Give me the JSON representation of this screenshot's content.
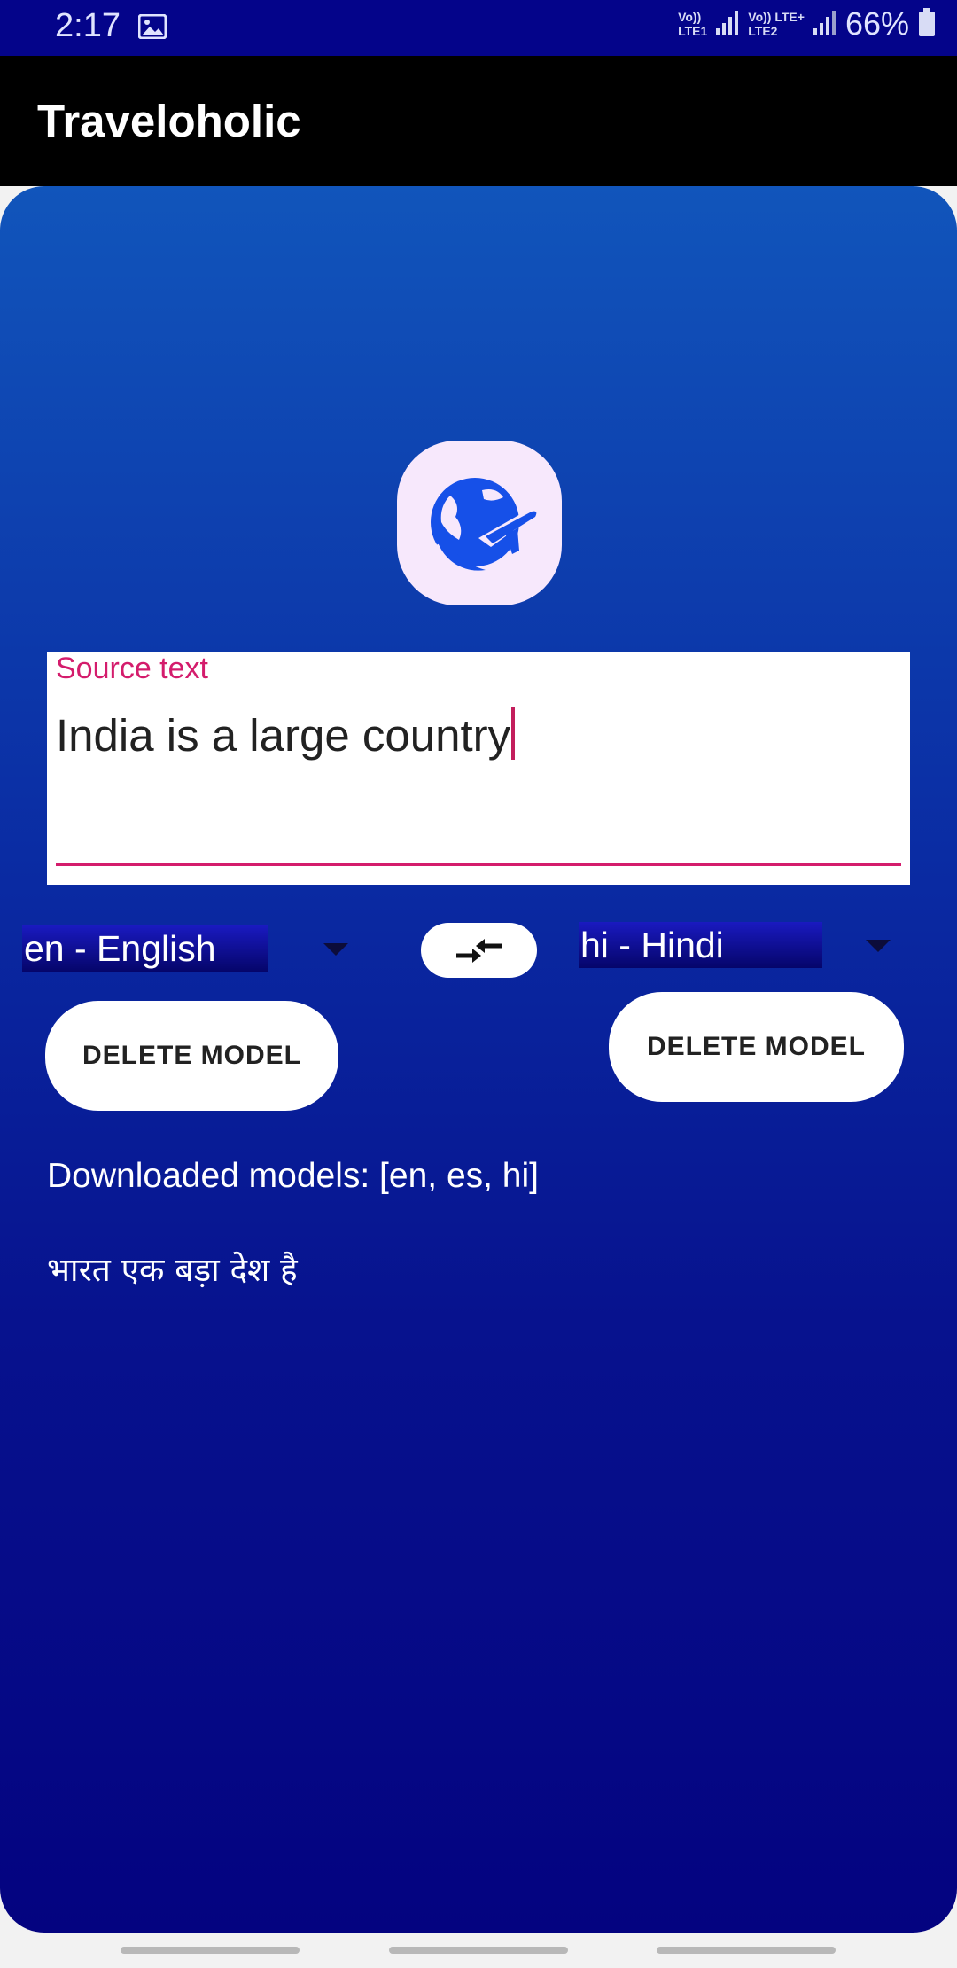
{
  "status_bar": {
    "time": "2:17",
    "sim1_label_top": "Vo))",
    "sim1_label_bottom": "LTE1",
    "sim2_label_top": "Vo)) LTE+",
    "sim2_label_bottom": "LTE2",
    "battery": "66%",
    "icons": [
      "gallery-icon",
      "signal-icon",
      "signal-icon",
      "battery-icon"
    ]
  },
  "app_bar": {
    "title": "Traveloholic"
  },
  "logo": {
    "icon": "globe-plane-icon",
    "accent": "#1650e8",
    "background": "#f7e8fc"
  },
  "source": {
    "label": "Source text",
    "value": "India is a large country"
  },
  "languages": {
    "source_selected": "en - English",
    "target_selected": "hi - Hindi",
    "swap_icon": "swap-arrows-icon"
  },
  "buttons": {
    "delete_left": "DELETE MODEL",
    "delete_right": "DELETE MODEL"
  },
  "models_text": "Downloaded models: [en, es, hi]",
  "output_text": "भारत एक बड़ा देश है",
  "colors": {
    "status_bar": "#04048a",
    "app_bar": "#000000",
    "accent": "#d41c6c",
    "card_top": "#1155bb",
    "card_bottom": "#040380"
  }
}
